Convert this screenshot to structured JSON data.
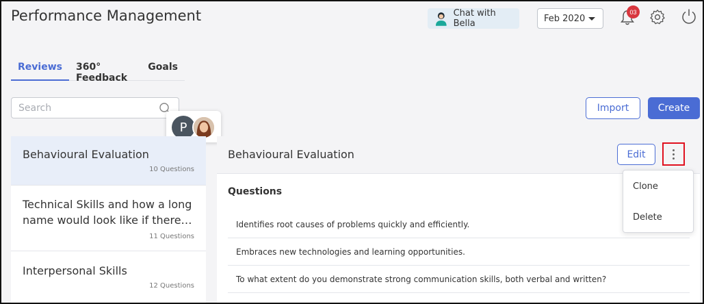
{
  "header": {
    "title": "Performance Management",
    "chat_label": "Chat with Bella",
    "month": "Feb 2020",
    "notification_count": "03"
  },
  "tabs": [
    {
      "label": "Reviews",
      "active": true
    },
    {
      "label": "360° Feedback",
      "active": false
    },
    {
      "label": "Goals",
      "active": false
    }
  ],
  "search": {
    "placeholder": "Search"
  },
  "avatars": {
    "initial": "P"
  },
  "actions": {
    "import_label": "Import",
    "create_label": "Create"
  },
  "reviews": [
    {
      "name": "Behavioural Evaluation",
      "count": "10 Questions",
      "selected": true
    },
    {
      "name": "Technical Skills and how a long name would look like if there…",
      "count": "11 Questions",
      "selected": false
    },
    {
      "name": "Interpersonal Skills",
      "count": "12 Questions",
      "selected": false
    }
  ],
  "detail": {
    "title": "Behavioural Evaluation",
    "edit_label": "Edit",
    "questions_heading": "Questions",
    "questions": [
      "Identifies root causes of problems quickly and efficiently.",
      "Embraces new technologies and learning opportunities.",
      "To what extent do you demonstrate strong communication skills, both verbal and written?"
    ]
  },
  "menu": {
    "items": [
      "Clone",
      "Delete"
    ]
  },
  "colors": {
    "accent": "#4a6cd4",
    "badge": "#d8363e",
    "highlight_border": "#e0101e"
  }
}
